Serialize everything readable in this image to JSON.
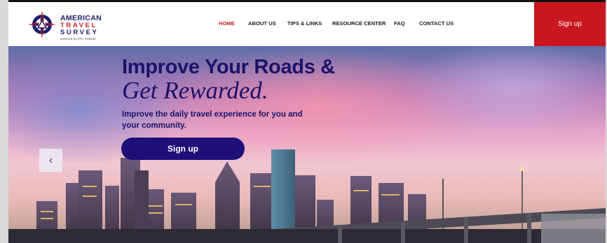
{
  "logo": {
    "line1": "AMERICAN",
    "line2": "TRAVEL",
    "line3": "SURVEY",
    "tagline": "powered by ETC Institute"
  },
  "nav": {
    "items": [
      {
        "label": "HOME",
        "active": true
      },
      {
        "label": "ABOUT US",
        "active": false
      },
      {
        "label": "TIPS & LINKS",
        "active": false
      },
      {
        "label": "RESOURCE CENTER",
        "active": false
      },
      {
        "label": "FAQ",
        "active": false
      },
      {
        "label": "CONTACT US",
        "active": false
      }
    ],
    "active_color": "#c8171e",
    "signup_label": "Sign up"
  },
  "hero": {
    "headline_line1": "Improve Your Roads &",
    "headline_line2": "Get Rewarded.",
    "subheading": "Improve the daily travel experience for you and your community.",
    "cta_label": "Sign up",
    "prev_icon": "chevron-left-icon"
  },
  "colors": {
    "brand_navy": "#1b136b",
    "brand_red": "#c8171e",
    "cta_bg": "#1f0f78"
  }
}
